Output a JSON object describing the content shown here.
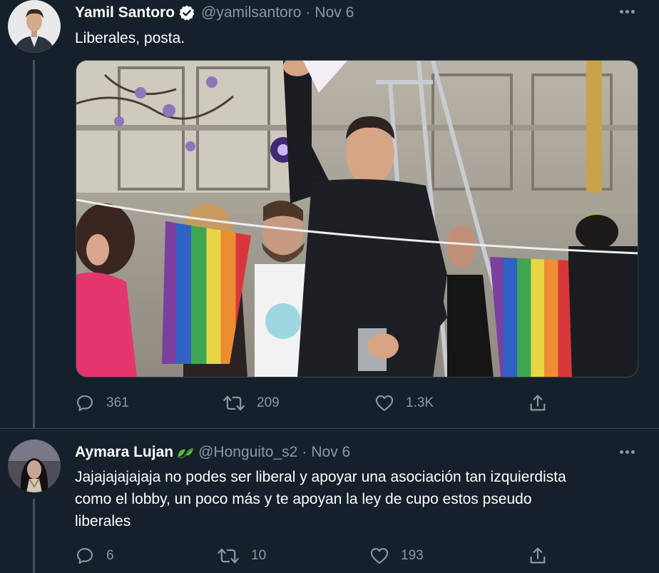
{
  "tweets": [
    {
      "name": "Yamil Santoro",
      "handle": "@yamilsantoro",
      "separator": "·",
      "date": "Nov 6",
      "text": "Liberales, posta.",
      "reply_count": "361",
      "retweet_count": "209",
      "like_count": "1.3K"
    },
    {
      "name": "Aymara Lujan",
      "handle": "@Honguito_s2",
      "separator": "·",
      "date": "Nov 6",
      "text_lines": [
        "Jajajajajajaja no podes ser liberal y apoyar una asociación tan izquierdista",
        "como el lobby, un poco más y te apoyan la ley de cupo estos pseudo",
        "liberales"
      ],
      "reply_count": "6",
      "retweet_count": "10",
      "like_count": "193"
    }
  ],
  "colors": {
    "background": "#15202b",
    "secondary_text": "#8899a6",
    "verified_badge": "#ffffff",
    "thread_line": "#3d5466"
  }
}
